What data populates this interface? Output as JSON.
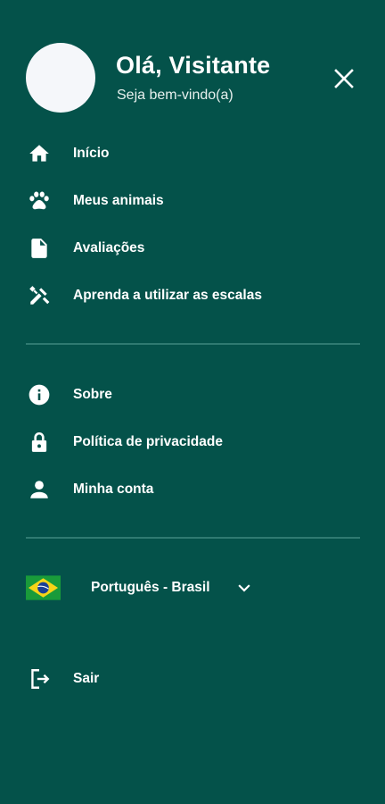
{
  "header": {
    "greeting": "Olá, Visitante",
    "subtitle": "Seja bem-vindo(a)",
    "close_icon": "close-icon"
  },
  "menu_primary": [
    {
      "label": "Início",
      "icon": "home-icon"
    },
    {
      "label": "Meus animais",
      "icon": "paw-icon"
    },
    {
      "label": "Avaliações",
      "icon": "document-icon"
    },
    {
      "label": "Aprenda a utilizar as escalas",
      "icon": "tools-icon"
    }
  ],
  "menu_secondary": [
    {
      "label": "Sobre",
      "icon": "info-icon"
    },
    {
      "label": "Política de privacidade",
      "icon": "lock-icon"
    },
    {
      "label": "Minha conta",
      "icon": "person-icon"
    }
  ],
  "language": {
    "selected": "Português - Brasil",
    "flag_icon": "brazil-flag-icon",
    "dropdown_icon": "chevron-down-icon"
  },
  "logout": {
    "label": "Sair",
    "icon": "logout-icon"
  },
  "colors": {
    "background": "#04524a",
    "divider": "#2f7a71",
    "text": "#ffffff",
    "avatar": "#f5f7fa"
  }
}
